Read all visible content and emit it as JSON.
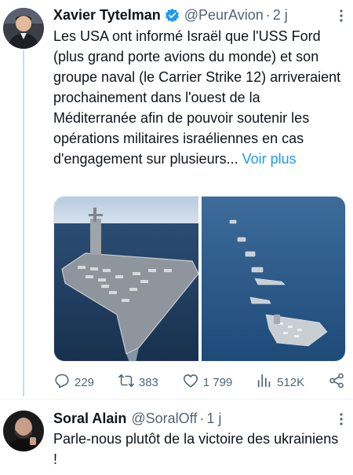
{
  "tweet": {
    "author_name": "Xavier Tytelman",
    "author_handle": "@PeurAvion",
    "separator": "·",
    "time": "2 j",
    "text": "Les USA ont informé Israël que l'USS Ford (plus grand porte avions du monde) et son groupe naval (le Carrier Strike 12) arriveraient prochainement dans l'ouest de la Méditerranée afin de pouvoir soutenir les opérations militaires israéliennes en cas d'engagement sur plusieurs...",
    "show_more": "Voir plus",
    "verified_icon": "verified-badge-icon",
    "images": [
      "aircraft-carrier-photo",
      "naval-group-formation-photo"
    ],
    "stats": {
      "replies": "229",
      "retweets": "383",
      "likes": "1 799",
      "views": "512K"
    }
  },
  "reply": {
    "author_name": "Soral Alain",
    "author_handle": "@SoralOff",
    "separator": "·",
    "time": "1 j",
    "text": "Parle-nous plutôt de la victoire des ukrainiens !"
  },
  "colors": {
    "accent": "#1d9bf0",
    "muted": "#536471",
    "text": "#0f1419",
    "thread_line": "#cfd9de"
  }
}
